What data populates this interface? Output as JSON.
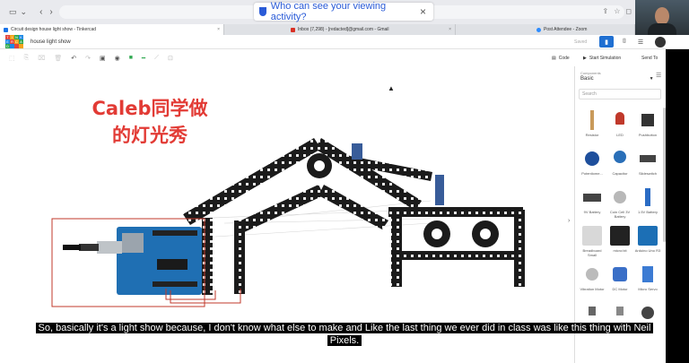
{
  "browser": {
    "privacy_banner": "Who can see your viewing activity?",
    "tabs": [
      {
        "label": "Circuit design house light show - Tinkercad",
        "active": true,
        "icon_color": "#1a73e8"
      },
      {
        "label": "Inbox (7,298) - [redacted]@gmail.com - Gmail",
        "active": false,
        "icon_color": "#d93025"
      },
      {
        "label": "Post Attendee - Zoom",
        "active": false,
        "icon_color": "#2d8cff"
      }
    ]
  },
  "header": {
    "logo_letters": [
      "T",
      "I",
      "N",
      "K",
      "E",
      "R",
      "C",
      "A",
      "D"
    ],
    "project_title": "house light show",
    "saved_label": "Saved"
  },
  "toolbar": {
    "code_label": "Code",
    "simulation_label": "Start Simulation",
    "send_to_label": "Send To"
  },
  "canvas": {
    "title_line1": "Caleb同学做",
    "title_line2": "的灯光秀"
  },
  "panel": {
    "components_label": "Components",
    "components_value": "Basic",
    "search_placeholder": "Search",
    "items": [
      {
        "name": "Resistor",
        "color": "#c99a5b"
      },
      {
        "name": "LED",
        "color": "#c0392b"
      },
      {
        "name": "Pushbutton",
        "color": "#333333"
      },
      {
        "name": "Potentiome...",
        "color": "#1e4f9c"
      },
      {
        "name": "Capacitor",
        "color": "#2a6fb8"
      },
      {
        "name": "Slideswitch",
        "color": "#444444"
      },
      {
        "name": "9V Battery",
        "color": "#444444"
      },
      {
        "name": "Coin Cell 3V Battery",
        "color": "#b8b8b8"
      },
      {
        "name": "1.5V Battery",
        "color": "#2b6cc4"
      },
      {
        "name": "Breadboard Small",
        "color": "#d8d8d8"
      },
      {
        "name": "micro:bit",
        "color": "#222222"
      },
      {
        "name": "Arduino Uno R3",
        "color": "#1c6fb5"
      },
      {
        "name": "Vibration Motor",
        "color": "#bbbbbb"
      },
      {
        "name": "DC Motor",
        "color": "#3a6fc7"
      },
      {
        "name": "Micro Servo",
        "color": "#3c7bd3"
      },
      {
        "name": "Bipolar Transistor",
        "color": "#666666"
      },
      {
        "name": "Transistor",
        "color": "#888888"
      },
      {
        "name": "Buzzer",
        "color": "#444444"
      }
    ]
  },
  "caption": {
    "line1": "So, basically it's a light show because, I don't know what else to make and Like the last thing we ever did in class was like this thing with Neil",
    "line2": "Pixels."
  }
}
